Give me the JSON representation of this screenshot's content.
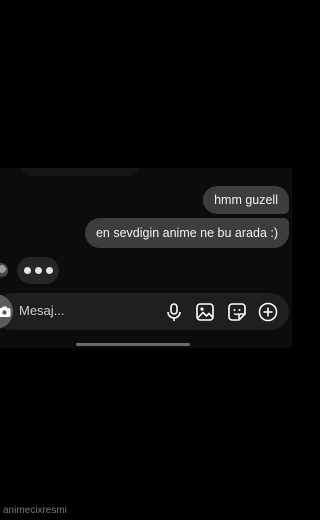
{
  "messages": [
    {
      "text": "hmm guzell",
      "from": "me"
    },
    {
      "text": "en sevdigin anime ne bu arada :)",
      "from": "me"
    }
  ],
  "composer": {
    "placeholder": "Mesaj...",
    "icons": [
      "camera-icon",
      "microphone-icon",
      "gallery-icon",
      "sticker-icon",
      "plus-icon"
    ]
  },
  "typing_indicator": {
    "dots": 3
  },
  "watermark": "animecixresmi",
  "colors": {
    "background": "#000000",
    "bubble": "#3d3d3d",
    "composer": "#1f1f1f"
  }
}
